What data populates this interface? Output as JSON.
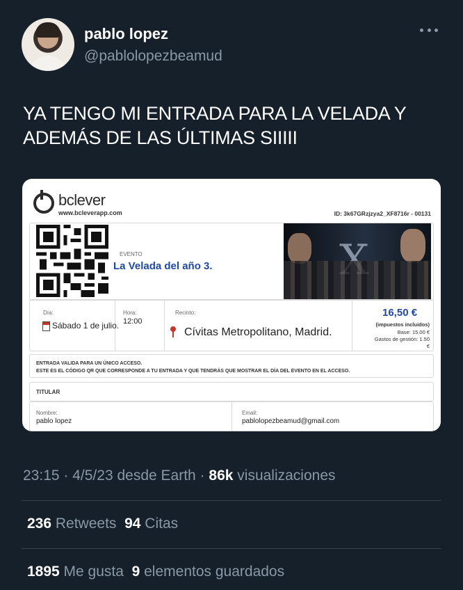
{
  "author": {
    "name": "pablo lopez",
    "handle": "@pablolopezbeamud"
  },
  "tweet": {
    "text_line1": "YA TENGO MI ENTRADA PARA LA VELADA Y",
    "text_line2": "ADEMÁS DE LAS ÚLTIMAS SIIIII"
  },
  "ticket": {
    "brand": "bclever",
    "url": "www.bcleverapp.com",
    "id": "ID: 3k67GRzjzya2_XF8716r - 00131",
    "evento_label": "EVENTO",
    "event_name": "La Velada del año 3.",
    "dia_label": "Día:",
    "date": "Sábado 1 de julio.",
    "hora_label": "Hora:",
    "time": "12:00",
    "recinto_label": "Recinto:",
    "venue": "Cívitas Metropolitano, Madrid.",
    "price": "16,50 €",
    "taxes_note": "(impuestos incluidos)",
    "base": "Base: 15.00 €",
    "fees": "Gastos de gestión: 1.50",
    "fees_currency": "€",
    "notice_line1": "ENTRADA VALIDA PARA UN ÚNICO ACCESO.",
    "notice_line2": "ESTE ES EL CÓDIGO QR QUE CORRESPONDE A TU ENTRADA Y QUE TENDRÁS QUE MOSTRAR EL DÍA DEL EVENTO EN EL ACCESO.",
    "titular_label": "TITULAR",
    "nombre_label": "Nombre:",
    "nombre": "pablo lopez",
    "email_label": "Email:",
    "email": "pablolopezbeamud@gmail.com"
  },
  "meta": {
    "time": "23:15",
    "sep1": " · ",
    "date": "4/5/23",
    "source": " desde Earth",
    "sep2": " · ",
    "views_count": "86k",
    "views_label": " visualizaciones"
  },
  "stats": {
    "retweets_count": "236",
    "retweets_label": " Retweets",
    "quotes_count": "94",
    "quotes_label": " Citas",
    "likes_count": "1895",
    "likes_label": " Me gusta",
    "bookmarks_count": "9",
    "bookmarks_label": " elementos guardados"
  },
  "icons": {
    "more": "more-horizontal-icon",
    "calendar": "calendar-icon",
    "location": "location-pin-icon"
  }
}
